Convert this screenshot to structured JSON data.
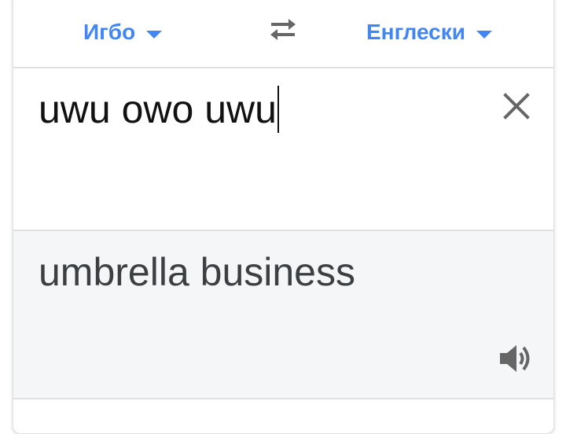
{
  "languages": {
    "source": "Игбо",
    "target": "Енглески"
  },
  "input": {
    "text": "uwu owo uwu"
  },
  "output": {
    "text": "umbrella business"
  },
  "icons": {
    "swap": "swap-arrows-icon",
    "clear": "close-icon",
    "listen": "speaker-icon",
    "dropdown": "caret-down-icon"
  },
  "colors": {
    "accent": "#4285f4",
    "icon": "#666666",
    "output_bg": "#f5f6f8"
  }
}
